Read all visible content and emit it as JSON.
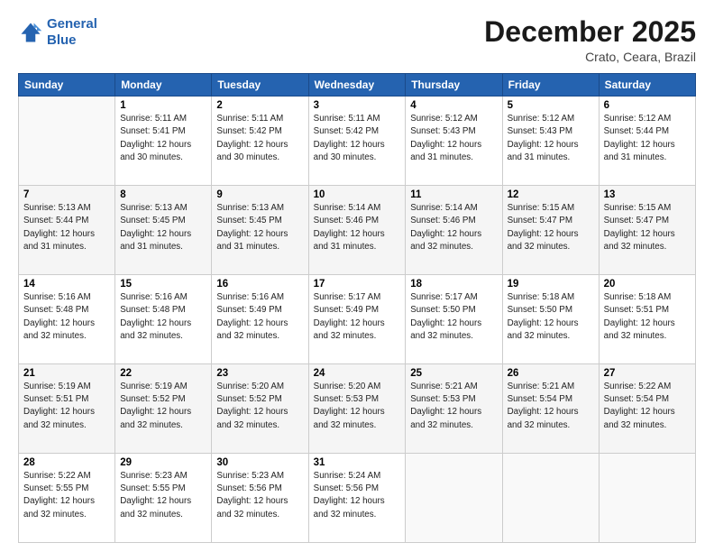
{
  "logo": {
    "line1": "General",
    "line2": "Blue"
  },
  "title": "December 2025",
  "subtitle": "Crato, Ceara, Brazil",
  "days_header": [
    "Sunday",
    "Monday",
    "Tuesday",
    "Wednesday",
    "Thursday",
    "Friday",
    "Saturday"
  ],
  "weeks": [
    [
      {
        "day": "",
        "info": ""
      },
      {
        "day": "1",
        "info": "Sunrise: 5:11 AM\nSunset: 5:41 PM\nDaylight: 12 hours\nand 30 minutes."
      },
      {
        "day": "2",
        "info": "Sunrise: 5:11 AM\nSunset: 5:42 PM\nDaylight: 12 hours\nand 30 minutes."
      },
      {
        "day": "3",
        "info": "Sunrise: 5:11 AM\nSunset: 5:42 PM\nDaylight: 12 hours\nand 30 minutes."
      },
      {
        "day": "4",
        "info": "Sunrise: 5:12 AM\nSunset: 5:43 PM\nDaylight: 12 hours\nand 31 minutes."
      },
      {
        "day": "5",
        "info": "Sunrise: 5:12 AM\nSunset: 5:43 PM\nDaylight: 12 hours\nand 31 minutes."
      },
      {
        "day": "6",
        "info": "Sunrise: 5:12 AM\nSunset: 5:44 PM\nDaylight: 12 hours\nand 31 minutes."
      }
    ],
    [
      {
        "day": "7",
        "info": "Sunrise: 5:13 AM\nSunset: 5:44 PM\nDaylight: 12 hours\nand 31 minutes."
      },
      {
        "day": "8",
        "info": "Sunrise: 5:13 AM\nSunset: 5:45 PM\nDaylight: 12 hours\nand 31 minutes."
      },
      {
        "day": "9",
        "info": "Sunrise: 5:13 AM\nSunset: 5:45 PM\nDaylight: 12 hours\nand 31 minutes."
      },
      {
        "day": "10",
        "info": "Sunrise: 5:14 AM\nSunset: 5:46 PM\nDaylight: 12 hours\nand 31 minutes."
      },
      {
        "day": "11",
        "info": "Sunrise: 5:14 AM\nSunset: 5:46 PM\nDaylight: 12 hours\nand 32 minutes."
      },
      {
        "day": "12",
        "info": "Sunrise: 5:15 AM\nSunset: 5:47 PM\nDaylight: 12 hours\nand 32 minutes."
      },
      {
        "day": "13",
        "info": "Sunrise: 5:15 AM\nSunset: 5:47 PM\nDaylight: 12 hours\nand 32 minutes."
      }
    ],
    [
      {
        "day": "14",
        "info": "Sunrise: 5:16 AM\nSunset: 5:48 PM\nDaylight: 12 hours\nand 32 minutes."
      },
      {
        "day": "15",
        "info": "Sunrise: 5:16 AM\nSunset: 5:48 PM\nDaylight: 12 hours\nand 32 minutes."
      },
      {
        "day": "16",
        "info": "Sunrise: 5:16 AM\nSunset: 5:49 PM\nDaylight: 12 hours\nand 32 minutes."
      },
      {
        "day": "17",
        "info": "Sunrise: 5:17 AM\nSunset: 5:49 PM\nDaylight: 12 hours\nand 32 minutes."
      },
      {
        "day": "18",
        "info": "Sunrise: 5:17 AM\nSunset: 5:50 PM\nDaylight: 12 hours\nand 32 minutes."
      },
      {
        "day": "19",
        "info": "Sunrise: 5:18 AM\nSunset: 5:50 PM\nDaylight: 12 hours\nand 32 minutes."
      },
      {
        "day": "20",
        "info": "Sunrise: 5:18 AM\nSunset: 5:51 PM\nDaylight: 12 hours\nand 32 minutes."
      }
    ],
    [
      {
        "day": "21",
        "info": "Sunrise: 5:19 AM\nSunset: 5:51 PM\nDaylight: 12 hours\nand 32 minutes."
      },
      {
        "day": "22",
        "info": "Sunrise: 5:19 AM\nSunset: 5:52 PM\nDaylight: 12 hours\nand 32 minutes."
      },
      {
        "day": "23",
        "info": "Sunrise: 5:20 AM\nSunset: 5:52 PM\nDaylight: 12 hours\nand 32 minutes."
      },
      {
        "day": "24",
        "info": "Sunrise: 5:20 AM\nSunset: 5:53 PM\nDaylight: 12 hours\nand 32 minutes."
      },
      {
        "day": "25",
        "info": "Sunrise: 5:21 AM\nSunset: 5:53 PM\nDaylight: 12 hours\nand 32 minutes."
      },
      {
        "day": "26",
        "info": "Sunrise: 5:21 AM\nSunset: 5:54 PM\nDaylight: 12 hours\nand 32 minutes."
      },
      {
        "day": "27",
        "info": "Sunrise: 5:22 AM\nSunset: 5:54 PM\nDaylight: 12 hours\nand 32 minutes."
      }
    ],
    [
      {
        "day": "28",
        "info": "Sunrise: 5:22 AM\nSunset: 5:55 PM\nDaylight: 12 hours\nand 32 minutes."
      },
      {
        "day": "29",
        "info": "Sunrise: 5:23 AM\nSunset: 5:55 PM\nDaylight: 12 hours\nand 32 minutes."
      },
      {
        "day": "30",
        "info": "Sunrise: 5:23 AM\nSunset: 5:56 PM\nDaylight: 12 hours\nand 32 minutes."
      },
      {
        "day": "31",
        "info": "Sunrise: 5:24 AM\nSunset: 5:56 PM\nDaylight: 12 hours\nand 32 minutes."
      },
      {
        "day": "",
        "info": ""
      },
      {
        "day": "",
        "info": ""
      },
      {
        "day": "",
        "info": ""
      }
    ]
  ]
}
